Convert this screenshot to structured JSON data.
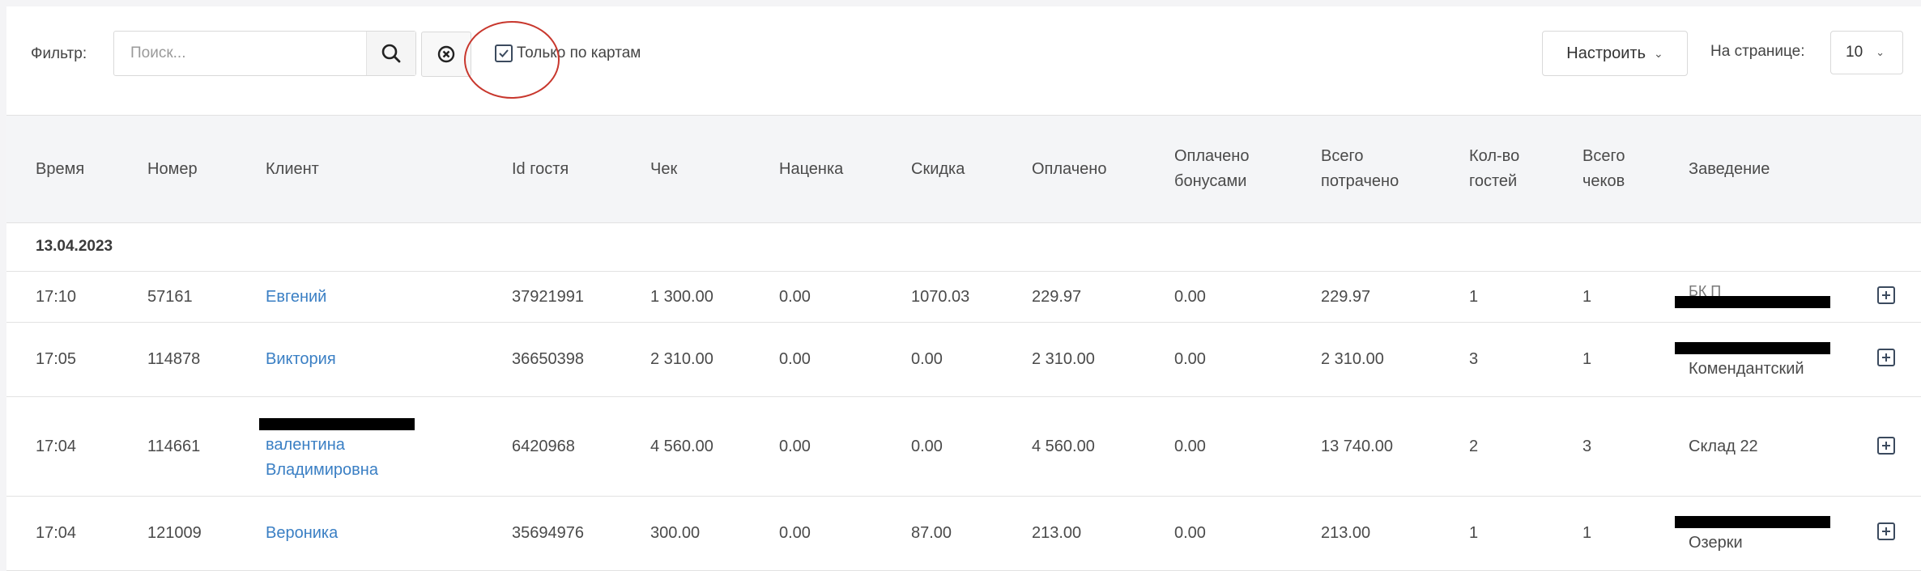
{
  "toolbar": {
    "filter_label": "Фильтр:",
    "search_placeholder": "Поиск...",
    "search_value": "",
    "only_cards_label": "Только по картам",
    "only_cards_checked": true,
    "configure_label": "Настроить",
    "per_page_label": "На странице:",
    "per_page_value": "10"
  },
  "table": {
    "columns": [
      "Время",
      "Номер",
      "Клиент",
      "Id гостя",
      "Чек",
      "Наценка",
      "Скидка",
      "Оплачено",
      "Оплачено бонусами",
      "Всего потрачено",
      "Кол-во гостей",
      "Всего чеков",
      "Заведение"
    ],
    "groups": [
      {
        "date": "13.04.2023",
        "rows": [
          {
            "time": "17:10",
            "number": "57161",
            "client": "Евгений",
            "guest_id": "37921991",
            "check": "1 300.00",
            "markup": "0.00",
            "discount": "1070.03",
            "paid": "229.97",
            "paid_bonus": "0.00",
            "total_spent": "229.97",
            "guests": "1",
            "checks": "1",
            "venue": "",
            "venue_partial": "БК П"
          },
          {
            "time": "17:05",
            "number": "114878",
            "client": "Виктория",
            "guest_id": "36650398",
            "check": "2 310.00",
            "markup": "0.00",
            "discount": "0.00",
            "paid": "2 310.00",
            "paid_bonus": "0.00",
            "total_spent": "2 310.00",
            "guests": "3",
            "checks": "1",
            "venue": "Комендантский"
          },
          {
            "time": "17:04",
            "number": "114661",
            "client": "валентина Владимировна",
            "guest_id": "6420968",
            "check": "4 560.00",
            "markup": "0.00",
            "discount": "0.00",
            "paid": "4 560.00",
            "paid_bonus": "0.00",
            "total_spent": "13 740.00",
            "guests": "2",
            "checks": "3",
            "venue": "Склад 22"
          },
          {
            "time": "17:04",
            "number": "121009",
            "client": "Вероника",
            "guest_id": "35694976",
            "check": "300.00",
            "markup": "0.00",
            "discount": "87.00",
            "paid": "213.00",
            "paid_bonus": "0.00",
            "total_spent": "213.00",
            "guests": "1",
            "checks": "1",
            "venue": "Озерки"
          }
        ]
      }
    ]
  },
  "colors": {
    "link": "#3a7fc4",
    "highlight": "#c8372d",
    "header_bg": "#f4f5f7"
  },
  "icons": [
    "search-icon",
    "clear-circle-x-icon",
    "checkmark-icon",
    "chevron-down-icon",
    "plus-square-icon"
  ]
}
